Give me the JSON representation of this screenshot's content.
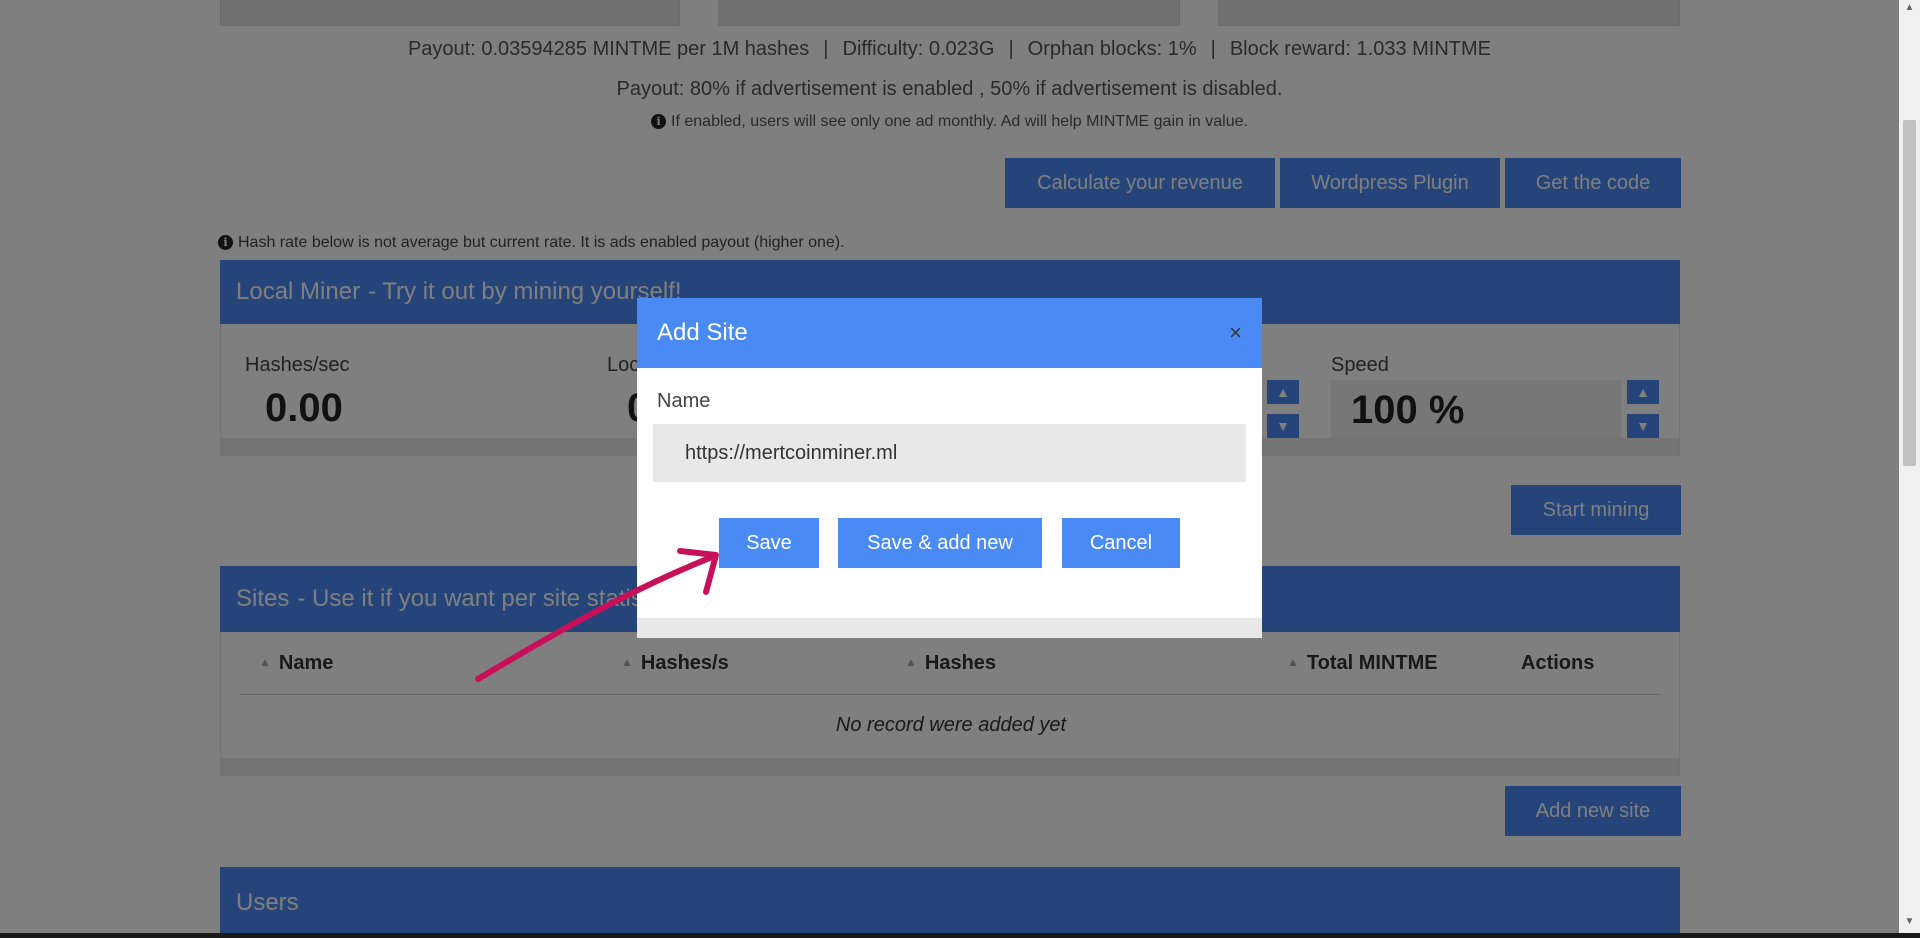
{
  "payout": {
    "rate": "Payout: 0.03594285 MINTME per 1M hashes",
    "difficulty": "Difficulty: 0.023G",
    "orphan": "Orphan blocks: 1%",
    "reward": "Block reward: 1.033 MINTME",
    "separator": "|",
    "ad_payout": "Payout: 80% if advertisement is enabled , 50% if advertisement is disabled.",
    "ad_notice": "If enabled, users will see only one ad monthly. Ad will help MINTME gain in value."
  },
  "actions": {
    "calculate": "Calculate your revenue",
    "wordpress": "Wordpress Plugin",
    "get_code": "Get the code"
  },
  "hash_note": "Hash rate below is not average but current rate. It is ads enabled payout (higher one).",
  "local_miner": {
    "title": "Local Miner",
    "subtitle": "- Try it out by mining yourself!",
    "hashes_label": "Hashes/sec",
    "hashes_value": "0.00",
    "second_label": "Loc",
    "second_value": "0",
    "speed_label": "Speed",
    "speed_value": "100 %",
    "start_button": "Start mining"
  },
  "sites": {
    "title": "Sites",
    "subtitle": "- Use it if you want per site statisti",
    "columns": [
      "Name",
      "Hashes/s",
      "Hashes",
      "Total MINTME",
      "Actions"
    ],
    "empty": "No record were added yet",
    "add_button": "Add new site"
  },
  "users": {
    "title": "Users"
  },
  "modal": {
    "title": "Add Site",
    "close": "×",
    "name_label": "Name",
    "name_value": "https://mertcoinminer.ml",
    "save": "Save",
    "save_add": "Save & add new",
    "cancel": "Cancel"
  },
  "icons": {
    "info": "info-icon",
    "sort": "sort-icon",
    "spin_up": "chevron-up-icon",
    "spin_down": "chevron-down-icon",
    "close": "close-icon",
    "arrow": "annotation-arrow"
  },
  "colors": {
    "accent": "#4a8af4",
    "arrow": "#c8105a",
    "overlay": "rgba(0,0,0,0.5)"
  }
}
